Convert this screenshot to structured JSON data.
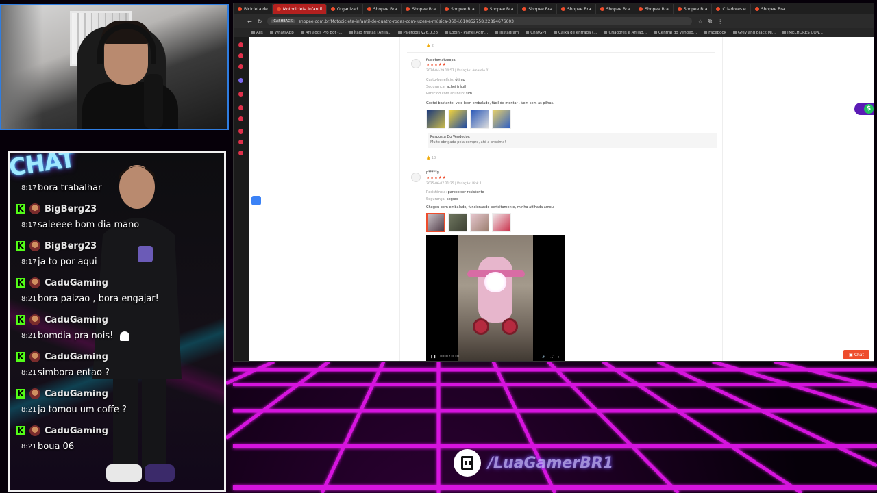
{
  "browser": {
    "tabs": [
      {
        "label": "Bicicleta de",
        "active": false
      },
      {
        "label": "Motocicleta infantil",
        "active": true
      },
      {
        "label": "Organizad",
        "active": false
      },
      {
        "label": "Shopee Bra",
        "active": false
      },
      {
        "label": "Shopee Bra",
        "active": false
      },
      {
        "label": "Shopee Bra",
        "active": false
      },
      {
        "label": "Shopee Bra",
        "active": false
      },
      {
        "label": "Shopee Bra",
        "active": false
      },
      {
        "label": "Shopee Bra",
        "active": false
      },
      {
        "label": "Shopee Bra",
        "active": false
      },
      {
        "label": "Shopee Bra",
        "active": false
      },
      {
        "label": "Shopee Bra",
        "active": false
      },
      {
        "label": "Criadores e",
        "active": false
      },
      {
        "label": "Shopee Bra",
        "active": false
      }
    ],
    "url_badge": "CASHBACK",
    "url": "shopee.com.br/Motocicleta-infantil-de-quatro-rodas-com-luzes-e-música-360-i.610852758.22894676603",
    "bookmarks": [
      "Alis",
      "WhatsApp",
      "Afiliados Pro Bot -...",
      "Ítalo Freitas [Afilia...",
      "Paletools v26.0.28",
      "Login - Painel Adm...",
      "Instagram",
      "ChatGPT",
      "Caixa de entrada (...",
      "Criadores e Afiliad...",
      "Central do Vended...",
      "Facebook",
      "Grey and Black Mi...",
      "[MELHORES CON..."
    ]
  },
  "reviews": {
    "top_likes": "2",
    "review1": {
      "username": "fabiotomatveopa",
      "stars": "★★★★★",
      "meta": "2024-04-29 10:57 | Variação: Amarelo 01",
      "attrs": [
        {
          "label": "Custo-benefício:",
          "value": "ótimo"
        },
        {
          "label": "Segurança:",
          "value": "achei frágil"
        },
        {
          "label": "Parecido com anúncio:",
          "value": "sim"
        }
      ],
      "text": "Gostei bastante, veio bem embalado, fácil de montar . Vem sem as pilhas.",
      "reply_title": "Resposta Do Vendedor:",
      "reply_text": "Muito obrigada pela compra, até a próxima!",
      "likes": "13"
    },
    "review2": {
      "username": "p*****g",
      "stars": "★★★★★",
      "meta": "2025-06-07 21:25 | Variação: Pink 1",
      "attrs": [
        {
          "label": "Resistência:",
          "value": "parece ser resistente"
        },
        {
          "label": "Segurança:",
          "value": "seguro"
        }
      ],
      "text": "Chegou bem embalado, funcionando perfeitamente, minha afilhada amou",
      "video_time": "0:00 / 0:10"
    },
    "chat_button": "Chat"
  },
  "chat": {
    "logo": "CHAT",
    "messages": [
      {
        "time": "8:17",
        "user": "",
        "text": "bora trabalhar"
      },
      {
        "time": "8:17",
        "user": "BigBerg23",
        "text": "saleeee bom dia mano"
      },
      {
        "time": "8:17",
        "user": "BigBerg23",
        "text": "ja to por aqui"
      },
      {
        "time": "8:21",
        "user": "CaduGaming",
        "text": "bora paizao , bora engajar!"
      },
      {
        "time": "8:21",
        "user": "CaduGaming",
        "text": "bomdia pra nois!"
      },
      {
        "time": "8:21",
        "user": "CaduGaming",
        "text": "simbora entao ?"
      },
      {
        "time": "8:21",
        "user": "CaduGaming",
        "text": "ja tomou um coffe ?"
      },
      {
        "time": "8:21",
        "user": "CaduGaming",
        "text": "boua 06"
      }
    ],
    "kick_glyph": "K"
  },
  "brand": {
    "name": "/LuaGamerBR1"
  },
  "colors": {
    "shopee_orange": "#ee4d2d",
    "neon_magenta": "#e016e8",
    "kick_green": "#53fc18",
    "active_tab": "#b3201f"
  }
}
